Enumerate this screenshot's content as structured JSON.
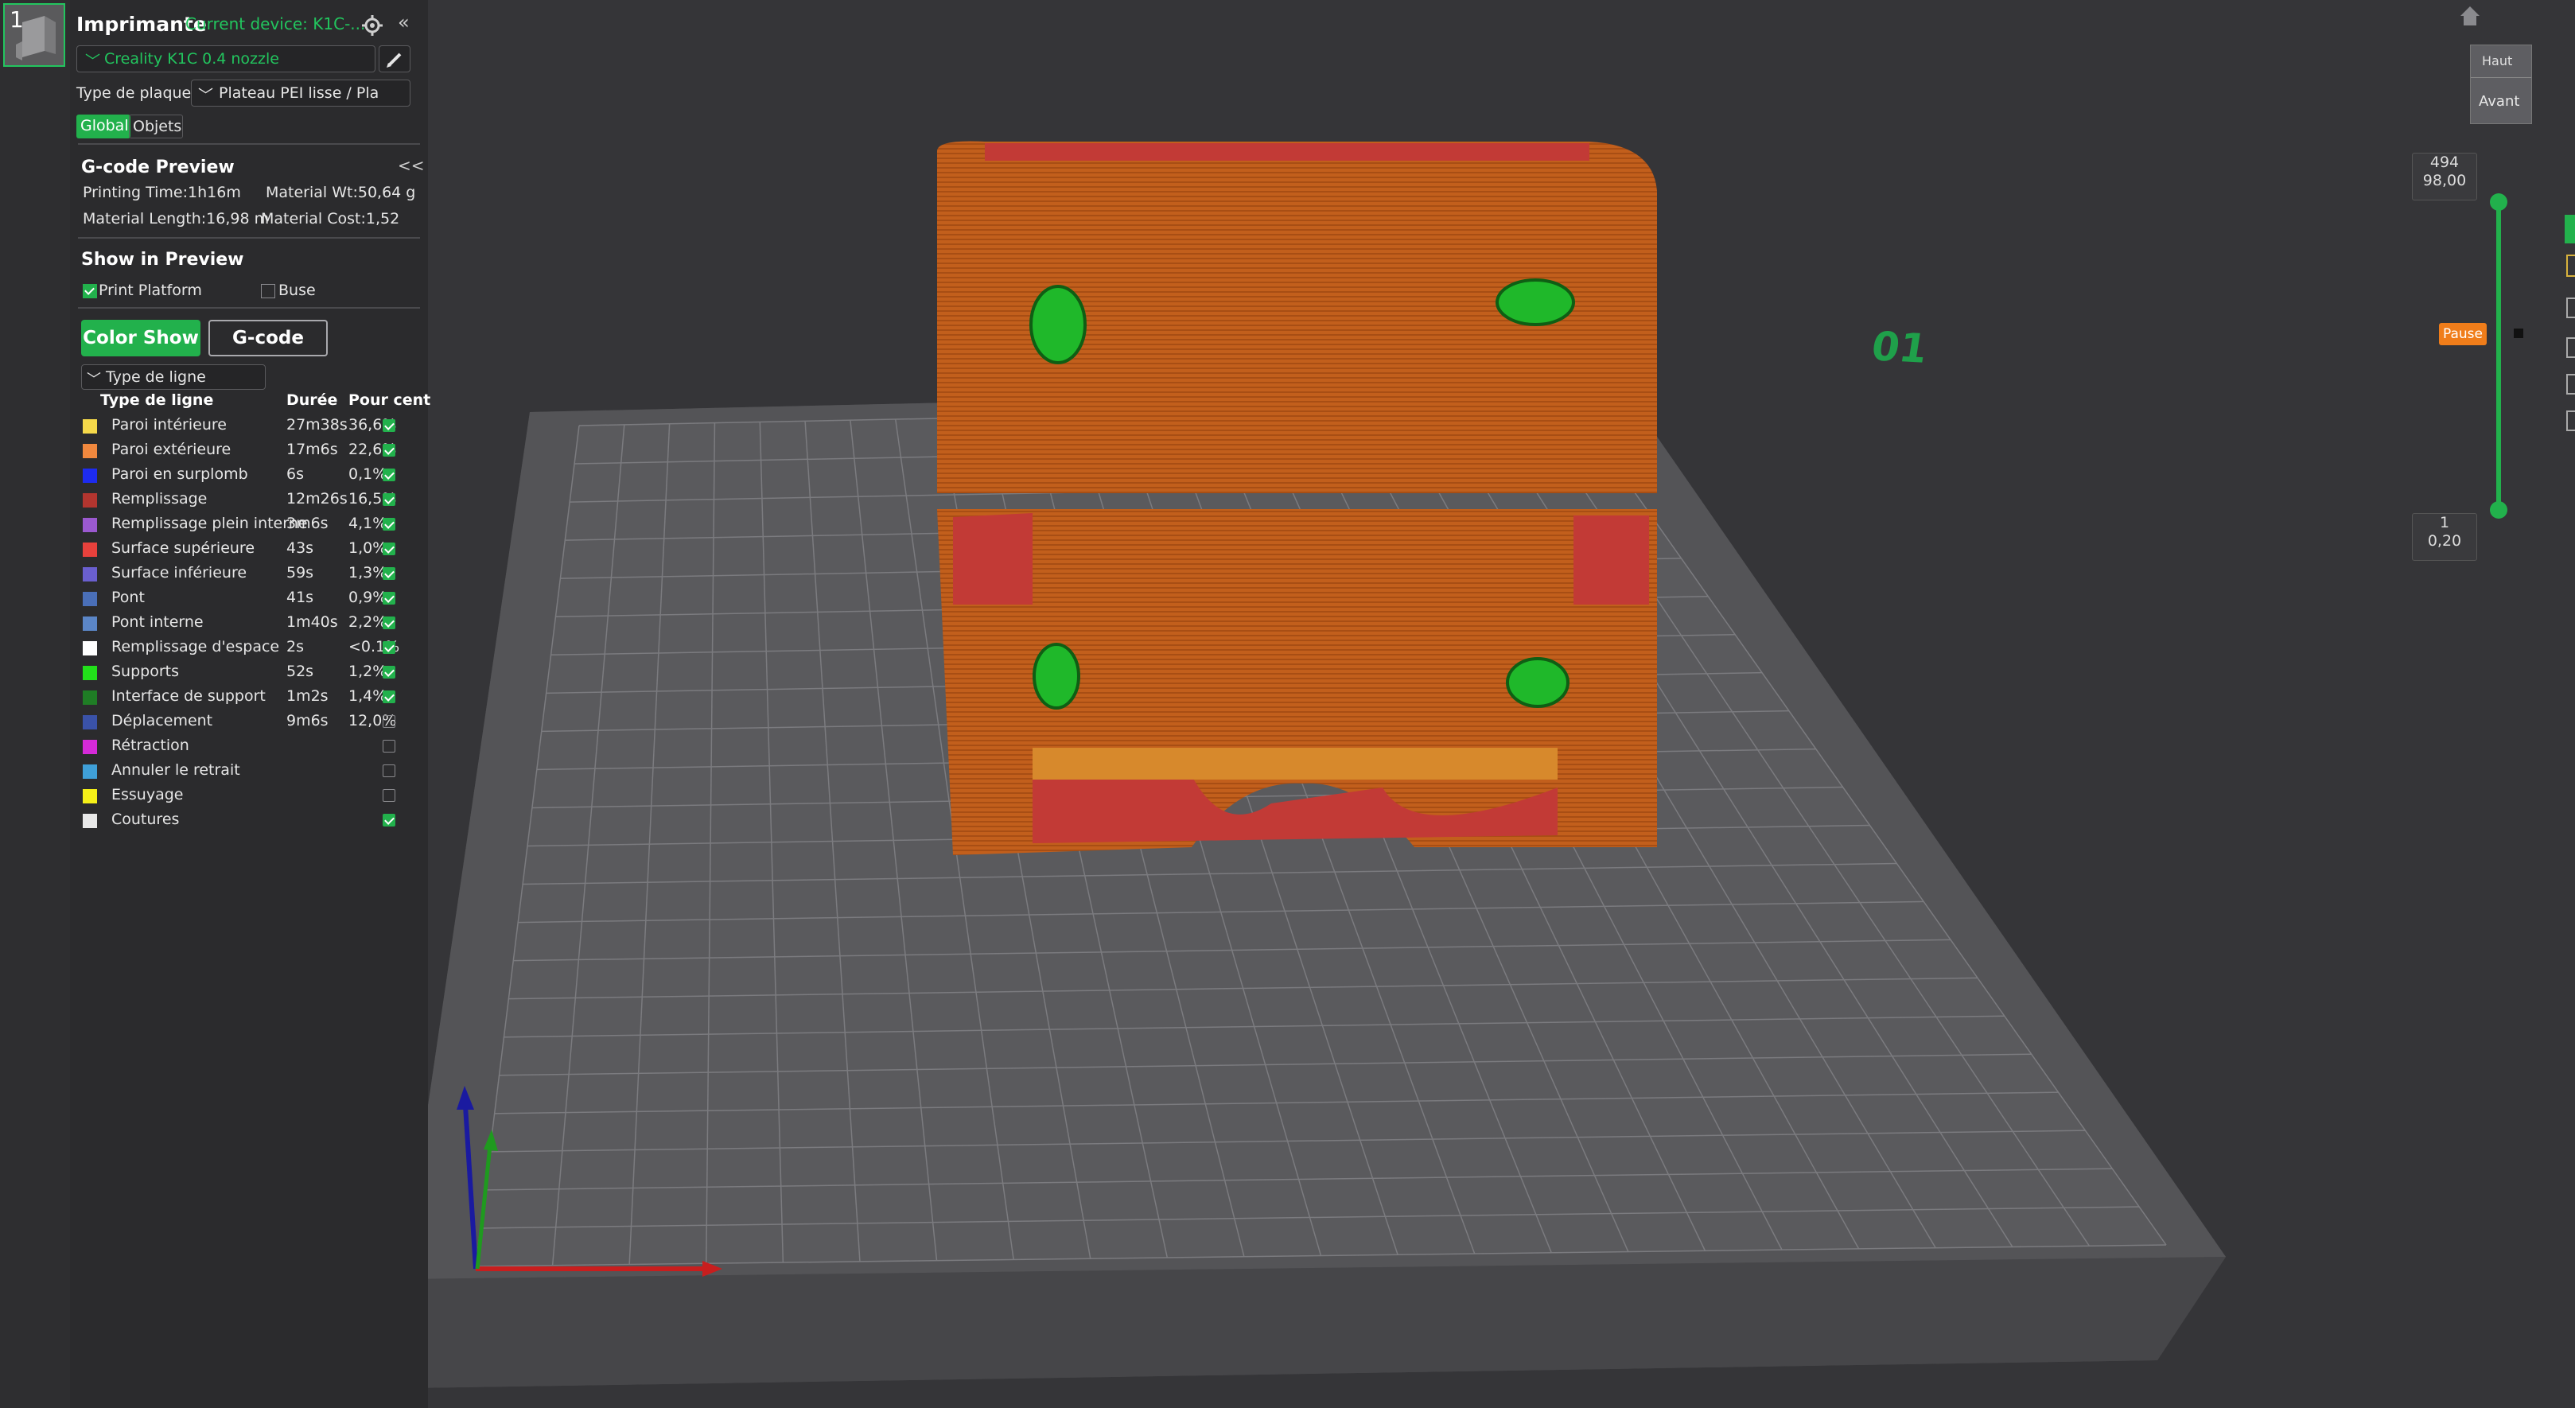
{
  "thumbnail": {
    "plate_number": "1"
  },
  "printer": {
    "title": "Imprimante",
    "current_device": "Current device: K1C-...",
    "preset": "Creality K1C 0.4 nozzle",
    "plate_type_label": "Type de plaque",
    "plate_type_value": "Plateau PEI lisse / Pla",
    "tabs": [
      "Global",
      "Objets"
    ]
  },
  "gcode_preview": {
    "title": "G-code Preview",
    "collapse": "<<",
    "printing_time": "Printing Time:1h16m",
    "material_wt": "Material Wt:50,64 g",
    "material_length": "Material Length:16,98 m",
    "material_cost": "Material Cost:1,52"
  },
  "show_in_preview": {
    "title": "Show in Preview",
    "print_platform": "Print Platform",
    "print_platform_checked": true,
    "buse": "Buse",
    "buse_checked": false
  },
  "buttons": {
    "color_show": "Color Show",
    "gcode": "G-code"
  },
  "line_type_dropdown": "Type de ligne",
  "legend": {
    "headers": [
      "Type de ligne",
      "Durée",
      "Pour cent"
    ],
    "rows": [
      {
        "name": "Paroi intérieure",
        "duration": "27m38s",
        "percent": "36,6%",
        "color": "#f5d94a",
        "checked": true
      },
      {
        "name": "Paroi extérieure",
        "duration": "17m6s",
        "percent": "22,6%",
        "color": "#f0883e",
        "checked": true
      },
      {
        "name": "Paroi en surplomb",
        "duration": "6s",
        "percent": "0,1%",
        "color": "#1d2bf0",
        "checked": true
      },
      {
        "name": "Remplissage",
        "duration": "12m26s",
        "percent": "16,5%",
        "color": "#b3352f",
        "checked": true
      },
      {
        "name": "Remplissage plein interne",
        "duration": "3m6s",
        "percent": "4,1%",
        "color": "#9b59d0",
        "checked": true
      },
      {
        "name": "Surface supérieure",
        "duration": "43s",
        "percent": "1,0%",
        "color": "#e8413c",
        "checked": true
      },
      {
        "name": "Surface inférieure",
        "duration": "59s",
        "percent": "1,3%",
        "color": "#6a5fcf",
        "checked": true
      },
      {
        "name": "Pont",
        "duration": "41s",
        "percent": "0,9%",
        "color": "#4a6fb8",
        "checked": true
      },
      {
        "name": "Pont interne",
        "duration": "1m40s",
        "percent": "2,2%",
        "color": "#5b86c7",
        "checked": true
      },
      {
        "name": "Remplissage d'espace",
        "duration": "2s",
        "percent": "<0.1%",
        "color": "#ffffff",
        "checked": true
      },
      {
        "name": "Supports",
        "duration": "52s",
        "percent": "1,2%",
        "color": "#22e01a",
        "checked": true
      },
      {
        "name": "Interface de support",
        "duration": "1m2s",
        "percent": "1,4%",
        "color": "#1f7d25",
        "checked": true
      },
      {
        "name": "Déplacement",
        "duration": "9m6s",
        "percent": "12,0%",
        "color": "#3a52a8",
        "checked": false
      },
      {
        "name": "Rétraction",
        "duration": "",
        "percent": "",
        "color": "#d52ad8",
        "checked": false
      },
      {
        "name": "Annuler le retrait",
        "duration": "",
        "percent": "",
        "color": "#3fa0d8",
        "checked": false
      },
      {
        "name": "Essuyage",
        "duration": "",
        "percent": "",
        "color": "#f5f018",
        "checked": false
      },
      {
        "name": "Coutures",
        "duration": "",
        "percent": "",
        "color": "#e8e8e8",
        "checked": true
      }
    ]
  },
  "viewport": {
    "view_cube": {
      "top": "Haut",
      "front": "Avant"
    },
    "plate_label": "01",
    "layer_slider": {
      "top_layer": "494",
      "top_height": "98,00",
      "bottom_layer": "1",
      "bottom_height": "0,20",
      "pause_label": "Pause"
    }
  },
  "colors": {
    "accent": "#22b14c",
    "model": "#c0601a",
    "pause": "#f07d1a"
  }
}
